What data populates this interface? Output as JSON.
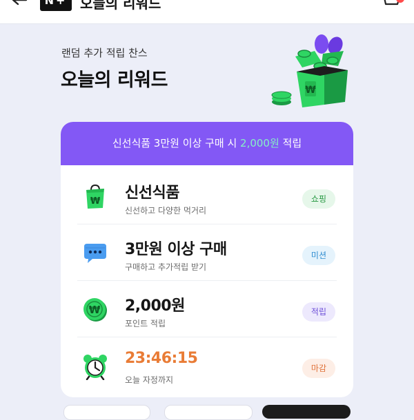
{
  "header": {
    "logo_text": "N+",
    "title": "오늘의 리워드"
  },
  "hero": {
    "subtitle": "랜덤 추가 적립 찬스",
    "title": "오늘의 리워드"
  },
  "banner": {
    "text_before": "신선식품 3만원 이상 구매 시 ",
    "highlight": "2,000원",
    "text_after": " 적립"
  },
  "rows": [
    {
      "title": "신선식품",
      "subtitle": "신선하고 다양한 먹거리",
      "tag": "쇼핑",
      "icon": "shopping-bag-icon"
    },
    {
      "title": "3만원 이상 구매",
      "subtitle": "구매하고 추가적립 받기",
      "tag": "미션",
      "icon": "chat-bubble-icon"
    },
    {
      "title": "2,000원",
      "subtitle": "포인트 적립",
      "tag": "적립",
      "icon": "coin-icon"
    },
    {
      "title": "23:46:15",
      "subtitle": "오늘 자정까지",
      "tag": "마감",
      "icon": "alarm-clock-icon"
    }
  ],
  "colors": {
    "background": "#eceef8",
    "accent_purple": "#8358f5",
    "highlight_mint": "#86efc7",
    "brand_green": "#2fd563",
    "countdown_orange": "#e97c36"
  }
}
